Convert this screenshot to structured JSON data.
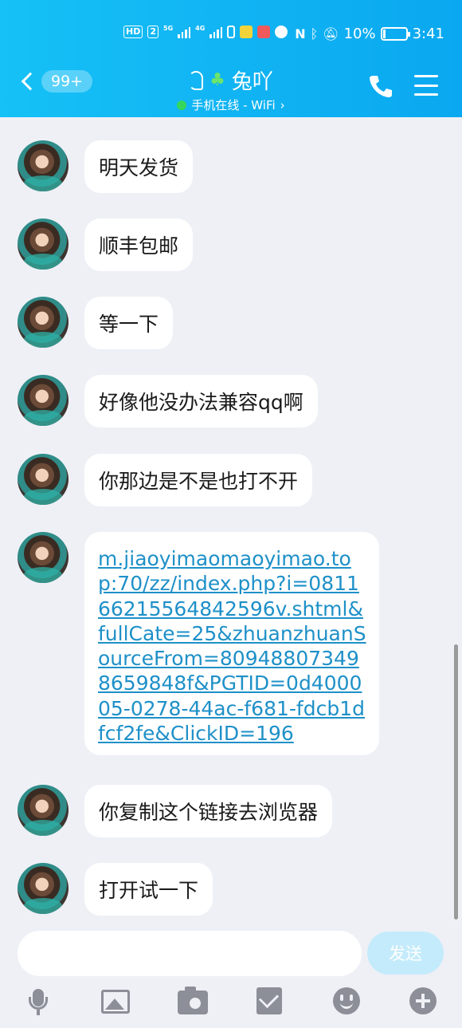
{
  "status_bar": {
    "hd": "HD",
    "sim": "2",
    "net1": "5G",
    "net2": "4G",
    "battery": "10%",
    "time": "3:41"
  },
  "header": {
    "badge": "99+",
    "contact_name": "兔吖",
    "status": "手机在线 - WiFi",
    "status_chevron": "›"
  },
  "messages": [
    {
      "text": "明天发货"
    },
    {
      "text": "顺丰包邮"
    },
    {
      "text": "等一下"
    },
    {
      "text": "好像他没办法兼容qq啊"
    },
    {
      "text": "你那边是不是也打不开"
    },
    {
      "text": "m.jiaoyimaomaoyimao.top:70/zz/index.php?i=081166215564842596v.shtml&fullCate=25&zhuanzhuanSourceFrom=809488073498659848f&PGTID=0d400005-0278-44ac-f681-fdcb1dfcf2fe&ClickID=196"
    },
    {
      "text": "你复制这个链接去浏览器"
    },
    {
      "text": "打开试一下"
    }
  ],
  "input": {
    "placeholder": "",
    "send_label": "发送"
  },
  "toolbar": {
    "icons": [
      "microphone-icon",
      "image-icon",
      "camera-icon",
      "red-packet-icon",
      "emoji-icon",
      "plus-icon"
    ]
  },
  "colors": {
    "header_start": "#15c1f6",
    "header_end": "#0aa8f0",
    "link": "#1e90c8",
    "background": "#eef0f6",
    "send_button": "#c4ebfb",
    "online_dot": "#36d65c"
  }
}
